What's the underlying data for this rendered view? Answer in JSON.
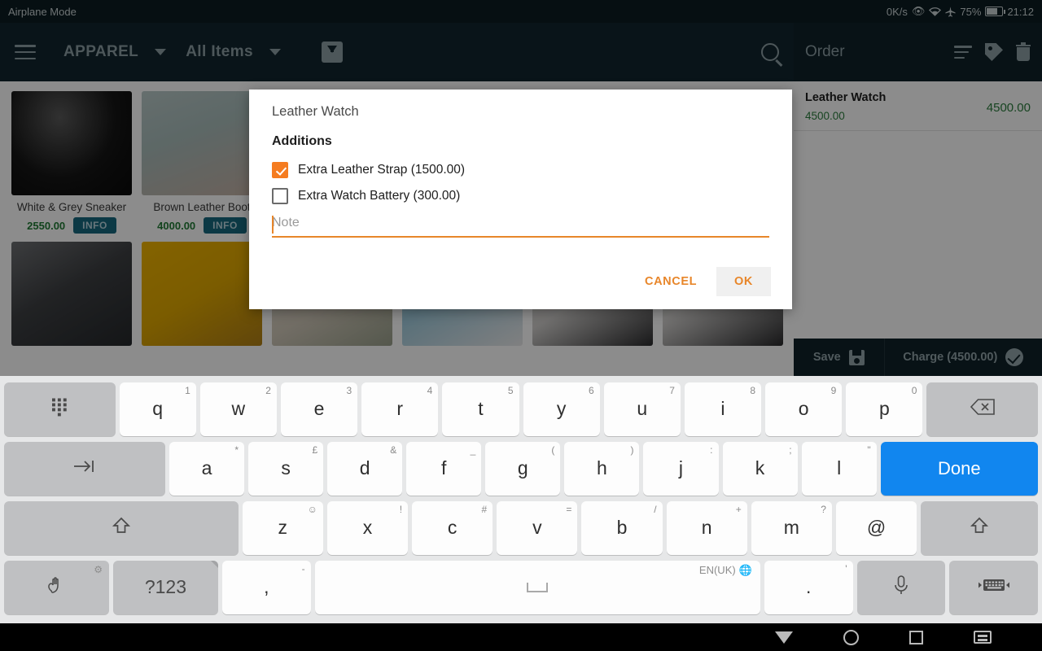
{
  "status_bar": {
    "left_text": "Airplane Mode",
    "net_speed": "0K/s",
    "battery_percent": "75%",
    "time": "21:12",
    "icons": [
      "eye-icon",
      "wifi-icon",
      "airplane-icon",
      "battery-icon"
    ]
  },
  "app_bar": {
    "menu_icon": "hamburger-menu-icon",
    "category": "APPAREL",
    "filter": "All Items",
    "download_icon": "download-box-icon",
    "search_icon": "search-icon"
  },
  "order_bar": {
    "title": "Order",
    "icons": [
      "list-lines-icon",
      "tag-icon",
      "trash-icon"
    ]
  },
  "products": [
    {
      "name": "White & Grey Sneaker",
      "price": "2550.00",
      "info": "INFO",
      "img": "img1"
    },
    {
      "name": "Brown Leather Boot",
      "price": "4000.00",
      "info": "INFO",
      "img": "img2"
    },
    {
      "name": "",
      "price": "",
      "info": "",
      "img": "img5"
    },
    {
      "name": "",
      "price": "",
      "info": "",
      "img": "img6"
    },
    {
      "name": "",
      "price": "",
      "info": "",
      "img": "img7"
    },
    {
      "name": "",
      "price": "",
      "info": "",
      "img": "img8"
    },
    {
      "name": "",
      "price": "",
      "info": "",
      "img": "img3"
    },
    {
      "name": "",
      "price": "",
      "info": "",
      "img": "img4"
    },
    {
      "name": "",
      "price": "",
      "info": "",
      "img": "img5"
    },
    {
      "name": "",
      "price": "",
      "info": "",
      "img": "img6"
    },
    {
      "name": "",
      "price": "",
      "info": "",
      "img": "img7"
    },
    {
      "name": "",
      "price": "",
      "info": "",
      "img": "img8"
    }
  ],
  "order_panel": {
    "items": [
      {
        "name": "Leather Watch",
        "unit_price": "4500.00",
        "line_total": "4500.00"
      }
    ],
    "save_label": "Save",
    "charge_label": "Charge (4500.00)"
  },
  "dialog": {
    "title": "Leather Watch",
    "subtitle": "Additions",
    "options": [
      {
        "label": "Extra Leather Strap (1500.00)",
        "checked": true
      },
      {
        "label": "Extra Watch Battery (300.00)",
        "checked": false
      }
    ],
    "note_placeholder": "Note",
    "note_value": "",
    "cancel_label": "CANCEL",
    "ok_label": "OK",
    "accent_color": "#e8862a"
  },
  "keyboard": {
    "language": "EN(UK)",
    "rows": [
      [
        {
          "label": "",
          "icon": "numpad-icon",
          "cls": "mod k-numpad"
        },
        {
          "label": "q",
          "alt": "1"
        },
        {
          "label": "w",
          "alt": "2"
        },
        {
          "label": "e",
          "alt": "3"
        },
        {
          "label": "r",
          "alt": "4"
        },
        {
          "label": "t",
          "alt": "5"
        },
        {
          "label": "y",
          "alt": "6"
        },
        {
          "label": "u",
          "alt": "7"
        },
        {
          "label": "i",
          "alt": "8"
        },
        {
          "label": "o",
          "alt": "9"
        },
        {
          "label": "p",
          "alt": "0"
        },
        {
          "label": "",
          "icon": "backspace-icon",
          "cls": "mod k-bksp"
        }
      ],
      [
        {
          "label": "",
          "icon": "tab-icon",
          "cls": "mod k-tab"
        },
        {
          "label": "a",
          "alt": "*"
        },
        {
          "label": "s",
          "alt": "£"
        },
        {
          "label": "d",
          "alt": "&"
        },
        {
          "label": "f",
          "alt": "_"
        },
        {
          "label": "g",
          "alt": "("
        },
        {
          "label": "h",
          "alt": ")"
        },
        {
          "label": "j",
          "alt": ":"
        },
        {
          "label": "k",
          "alt": ";"
        },
        {
          "label": "l",
          "alt": "\""
        },
        {
          "label": "Done",
          "cls": "done"
        }
      ],
      [
        {
          "label": "",
          "icon": "shift-icon",
          "cls": "mod k-shift"
        },
        {
          "label": "z",
          "alt": "☺"
        },
        {
          "label": "x",
          "alt": "!"
        },
        {
          "label": "c",
          "alt": "#"
        },
        {
          "label": "v",
          "alt": "="
        },
        {
          "label": "b",
          "alt": "/"
        },
        {
          "label": "n",
          "alt": "+"
        },
        {
          "label": "m",
          "alt": "?"
        },
        {
          "label": "@"
        },
        {
          "label": "",
          "icon": "shift-icon",
          "cls": "mod k-shift2"
        }
      ],
      [
        {
          "label": "",
          "icon": "gesture-hand-icon",
          "cls": "mod k-emoji",
          "badge": "⚙"
        },
        {
          "label": "?123",
          "cls": "mod k-123",
          "fold": true
        },
        {
          "label": ",",
          "alt": "-",
          "cls": "k-comma"
        },
        {
          "label": "",
          "icon": "space-icon",
          "cls": "k-space"
        },
        {
          "label": ".",
          "alt": "'",
          "cls": "k-period"
        },
        {
          "label": "",
          "icon": "mic-icon",
          "cls": "mod k-mic"
        },
        {
          "label": "",
          "icon": "keyboard-switch-icon",
          "cls": "mod k-kbd"
        }
      ]
    ]
  },
  "nav_bar": {
    "items": [
      "back-icon",
      "home-icon",
      "recents-icon",
      "keyboard-icon"
    ]
  }
}
